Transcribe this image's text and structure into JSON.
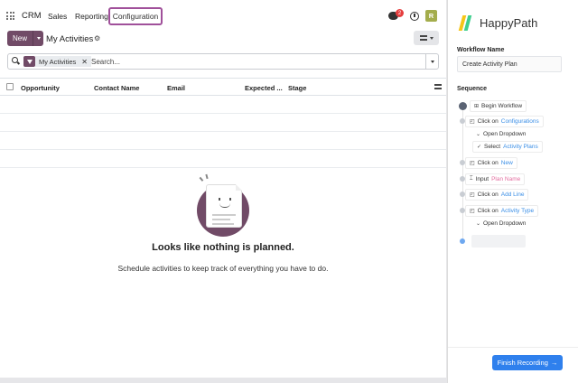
{
  "crm": {
    "brand": "CRM",
    "menu": [
      "Sales",
      "Reporting",
      "Configuration"
    ],
    "notifications_count": "2",
    "avatar_initial": "R",
    "new_button": "New",
    "view_title": "My Activities",
    "search": {
      "facet": "My Activities",
      "placeholder": "Search..."
    },
    "columns": [
      "Opportunity",
      "Contact Name",
      "Email",
      "Expected ...",
      "Stage"
    ],
    "empty_title": "Looks like nothing is planned.",
    "empty_subtitle": "Schedule activities to keep track of everything you have to do."
  },
  "happypath": {
    "brand": "HappyPath",
    "brand_colors": [
      "#f5c518",
      "#3ecf8e",
      "#2f80ed"
    ],
    "workflow_label": "Workflow Name",
    "workflow_name": "Create Activity Plan",
    "sequence_label": "Sequence",
    "steps": [
      {
        "prefix": "Begin Workflow",
        "target": ""
      },
      {
        "prefix": "Click on",
        "target": "Configurations"
      },
      {
        "prefix": "Open Dropdown",
        "target": ""
      },
      {
        "prefix": "Select",
        "target": "Activity Plans"
      },
      {
        "prefix": "Click on",
        "target": "New"
      },
      {
        "prefix": "Input",
        "target": "Plan Name"
      },
      {
        "prefix": "Click on",
        "target": "Add Line"
      },
      {
        "prefix": "Click on",
        "target": "Activity Type"
      },
      {
        "prefix": "Open Dropdown",
        "target": ""
      }
    ],
    "finish_button": "Finish Recording",
    "finish_arrow": "→"
  }
}
